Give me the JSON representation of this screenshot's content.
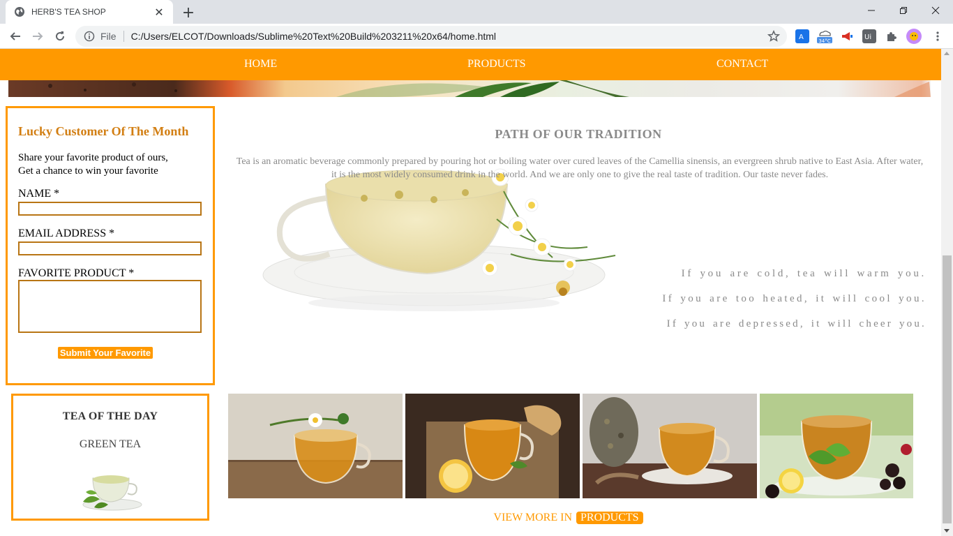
{
  "browser": {
    "tab_title": "HERB'S TEA SHOP",
    "file_label": "File",
    "url": "C:/Users/ELCOT/Downloads/Sublime%20Text%20Build%203211%20x64/home.html",
    "weather_badge": "34°C"
  },
  "nav": {
    "home": "HOME",
    "products": "PRODUCTS",
    "contact": "CONTACT"
  },
  "lucky": {
    "title": "Lucky Customer Of The Month",
    "line1": "Share your favorite product of ours,",
    "line2": "Get a chance to win your favorite",
    "name_label": "NAME *",
    "email_label": "EMAIL ADDRESS *",
    "favorite_label": "FAVORITE PRODUCT *",
    "submit_label": "Submit Your Favorite"
  },
  "tea_of_day": {
    "title": "TEA OF THE DAY",
    "name": "GREEN TEA"
  },
  "tradition": {
    "title": "PATH OF OUR TRADITION",
    "text": "Tea is an aromatic beverage commonly prepared by pouring hot or boiling water over cured leaves of the Camellia sinensis, an evergreen shrub native to East Asia. After water, it is the most widely consumed drink in the world. And we are only one to give the real taste of tradition. Our taste never fades.",
    "quote1": "If you are cold, tea will warm you.",
    "quote2": "If you are too heated, it will cool you.",
    "quote3": "If you are depressed, it will cheer you."
  },
  "view_more": {
    "prefix": "VIEW MORE IN",
    "link": "PRODUCTS"
  },
  "colors": {
    "accent": "#ff9900",
    "title_brown": "#d27e12",
    "text_grey": "#8a8a8a"
  }
}
